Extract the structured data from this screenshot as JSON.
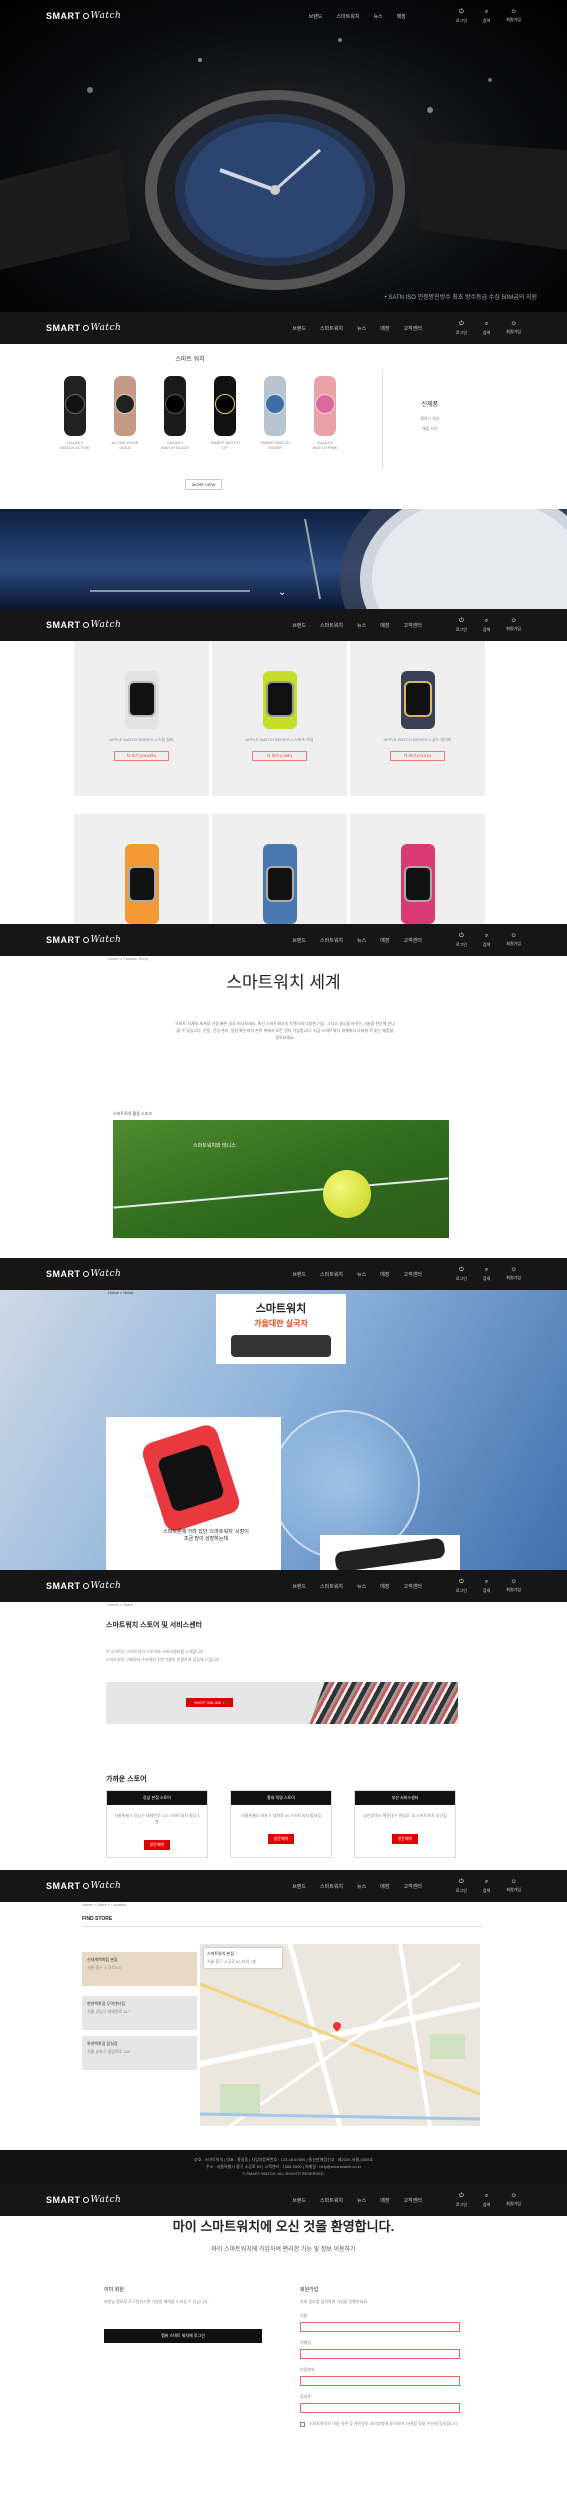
{
  "brand": {
    "logo_bold": "SMART",
    "logo_italic": "Watch"
  },
  "nav": {
    "menu": [
      "브랜드",
      "스마트워치",
      "뉴스",
      "매장",
      "고객센터"
    ],
    "icons": [
      {
        "icon": "power-icon",
        "label": "로그인"
      },
      {
        "icon": "search-icon",
        "label": "검색"
      },
      {
        "icon": "user-icon",
        "label": "회원가입"
      }
    ]
  },
  "hero": {
    "caption": "• SATN ISO 인증방진방수 최초 방수등급 수심 50M급의 지원"
  },
  "products": {
    "title": "스마트 워치",
    "items": [
      "GALAXY WATCH ACTIVE",
      "ACTIVE ROSE GOLD",
      "GALAXY WATCH BLACK",
      "SMART WATCH 10+",
      "SMART WATCH SILVER",
      "GALAXY WATCH PINK"
    ],
    "more": "MORE VIEW",
    "side_title": "신제품",
    "side_links": [
      "갤럭시 워치",
      "애플 워치"
    ]
  },
  "apple": {
    "items": [
      {
        "name": "APPLE WATCH SERIES 3 스틸 실버",
        "btn": "더 보기 (SILVER)"
      },
      {
        "name": "APPLE WATCH SERIES 3 스포츠 라임",
        "btn": "더 보기 (LIME)"
      },
      {
        "name": "APPLE WATCH SERIES 3 골드 네이비",
        "btn": "더 보기 (GOLD)"
      }
    ]
  },
  "world": {
    "breadcrumb": "Home > Fashion Shop",
    "title": "스마트워치 세계",
    "body": "스마트 시계의 세계로 가장 빠른 길로 떠나보세요. 최신 스마트워치의 트렌드와 다양한 기능, 그리고 일상을 바꾸는 기술을 한눈에 만나볼 수 있습니다. 운동, 건강 관리, 알림 확인까지 손목 위에서 모든 것이 가능합니다. 지금 스마트워치 세계에서 나에게 딱 맞는 제품을 찾아보세요.",
    "tennis_label": "스마트워치 활용 스포츠",
    "tennis_caption": "스마트워치와 테니스"
  },
  "promo": {
    "breadcrumb": "Home > News",
    "ad_title": "스마트워치",
    "ad_sub": "가을대란 실국자",
    "caption": "스마트폰에 가려 있던 '스마트워치' 시장이 조금 많이 성장하는데"
  },
  "service": {
    "breadcrumb": "Home > Store",
    "title": "스마트워치 스토어 및 서비스센터",
    "desc1": "이 사이트는 스마트워치 스토어와 서비스센터를 소개합니다.",
    "desc2": "스마트워치 구매부터 수리까지 전문가들이 친절하게 상담해 드립니다.",
    "shop_now": "SHOP ONLINE >",
    "section": "가까운 스토어",
    "stores": [
      {
        "name": "강남 본점 스토어",
        "desc": "서울특별시 강남구 테헤란로 123 스마트워치 빌딩 1층",
        "btn": "방문예약"
      },
      {
        "name": "홍대 직영 스토어",
        "desc": "서울특별시 마포구 양화로 45 스마트워치 홍대점",
        "btn": "방문예약"
      },
      {
        "name": "부산 서비스센터",
        "desc": "부산광역시 해운대구 센텀로 78 스마트워치 부산점",
        "btn": "방문예약"
      }
    ]
  },
  "findstore": {
    "breadcrumb": "Home > Store > Location",
    "title": "FIND STORE",
    "list": [
      {
        "name": "신세계백화점 본점",
        "addr": "서울 중구 소공로 63"
      },
      {
        "name": "현대백화점 무역센터점",
        "addr": "서울 강남구 테헤란로 517"
      },
      {
        "name": "롯데백화점 잠실점",
        "addr": "서울 송파구 올림픽로 240"
      }
    ],
    "popup_name": "스마트워치 본점",
    "popup_addr": "서울 중구 소공로 63 지하 1층"
  },
  "footer": {
    "line1": "상호 : 스마트워치 | 대표 : 홍길동 | 사업자등록번호 : 123-45-67890 | 통신판매업신고 : 제2020-서울-0000호",
    "line2": "주소 : 서울특별시 중구 소공로 63 | 고객센터 : 1588-0000 | 이메일 : help@smartwatch.co.kr",
    "copyright": "© SMART WATCH. ALL RIGHTS RESERVED."
  },
  "welcome": {
    "title": "마이 스마트워치에 오신 것을 환영합니다.",
    "subtitle": "마이 스마트워치에 가입하여 편리한 기능 및 정보 이용하기",
    "left_title": "이미 회원",
    "left_desc": "회원님 정보로 로그인하시면 다양한 혜택을 누리실 수 있습니다.",
    "login_btn": "멤버 스마트 워치에 로그인",
    "right_title": "회원가입",
    "right_desc": "아래 정보를 입력하여 가입을 진행하세요.",
    "fields": [
      "이름",
      "이메일",
      "비밀번호",
      "휴대폰"
    ],
    "agree": "스마트워치의 이용 약관 및 개인정보 처리방침에 동의하며, 마케팅 정보 수신에 동의합니다."
  }
}
